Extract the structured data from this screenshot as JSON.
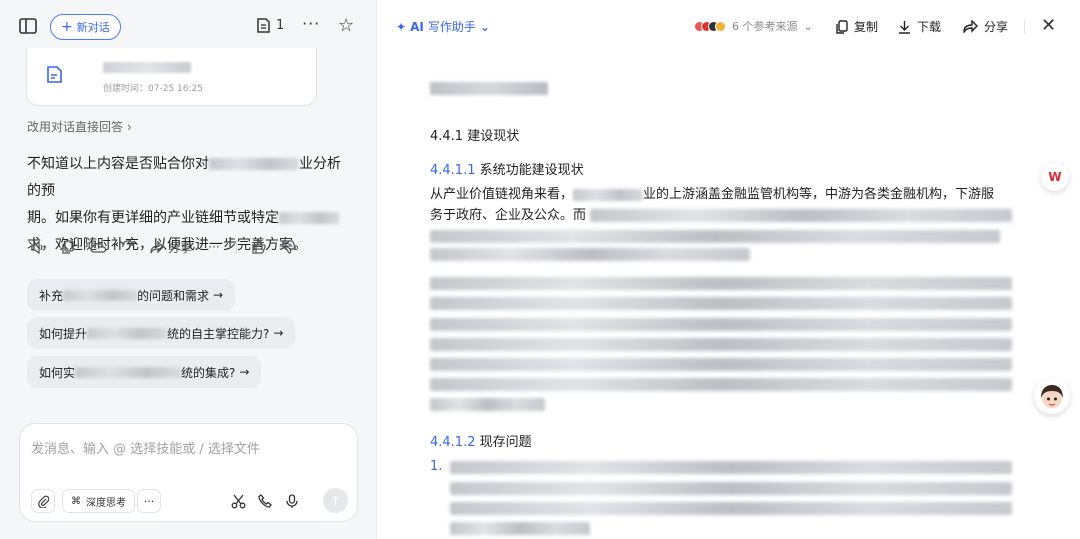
{
  "left": {
    "new_chat_label": "新对话",
    "doc_count": "1",
    "doc_card": {
      "date": "创建时间：07-25 16:25"
    },
    "alt_answer": "改用对话直接回答",
    "answer": {
      "p1a": "不知道以上内容是否贴合你对",
      "p1b": "业分析的预",
      "p2a": "期。如果你有更详细的产业链细节或特定",
      "p3": "求，欢迎随时补充，以便我进一步完善方案。"
    },
    "share_label": "分享",
    "suggestions": [
      {
        "a": "补充",
        "b": "的问题和需求"
      },
      {
        "a": "如何提升",
        "b": "统的自主掌控能力?"
      },
      {
        "a": "如何实",
        "b": "统的集成?"
      }
    ],
    "input_placeholder": "发消息、输入 @ 选择技能或 / 选择文件",
    "deep_think_label": "深度思考"
  },
  "right": {
    "ai_label": "AI",
    "ai_sub": "写作助手",
    "sources_label": "6 个参考来源",
    "copy_label": "复制",
    "download_label": "下载",
    "share_label": "分享",
    "wps_badge": "W",
    "doc": {
      "h1": "4.4.1 建设现状",
      "h2a_num": "4.4.1.1",
      "h2a_text": "系统功能建设现状",
      "p1a": "从产业价值链视角来看，",
      "p1b": "业的上游涵盖金融监管机构等，中游为各类金融机构，下游服",
      "p2a": "务于政府、企业及公众。而",
      "h2b_num": "4.4.1.2",
      "h2b_text": "现存问题",
      "item1": "1."
    }
  },
  "colors": {
    "accent": "#3a67e8",
    "wps_red": "#e0262e"
  }
}
